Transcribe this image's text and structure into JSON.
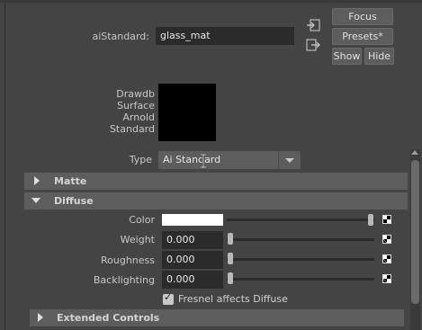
{
  "material": {
    "node_label": "aiStandard:",
    "node_value": "glass_mat"
  },
  "buttons": {
    "focus": "Focus",
    "presets": "Presets*",
    "show": "Show",
    "hide": "Hide"
  },
  "swatch": {
    "lines": [
      "Drawdb",
      "Surface",
      "Arnold",
      "Standard"
    ],
    "color": "#000000"
  },
  "type_row": {
    "label": "Type",
    "value": "Ai Standard"
  },
  "sections": {
    "matte": "Matte",
    "diffuse": "Diffuse",
    "extended": "Extended Controls"
  },
  "diffuse": {
    "color_label": "Color",
    "color_value": "#ffffff",
    "rows": [
      {
        "label": "Weight",
        "value": "0.000",
        "level": 0.0
      },
      {
        "label": "Roughness",
        "value": "0.000",
        "level": 0.0
      },
      {
        "label": "Backlighting",
        "value": "0.000",
        "level": 0.0
      }
    ],
    "fresnel_label": "Fresnel affects Diffuse",
    "fresnel_checked": true
  },
  "colors": {
    "panel_bg": "#444444",
    "field_bg": "#2b2b2b",
    "button_bg": "#5d5d5d"
  }
}
